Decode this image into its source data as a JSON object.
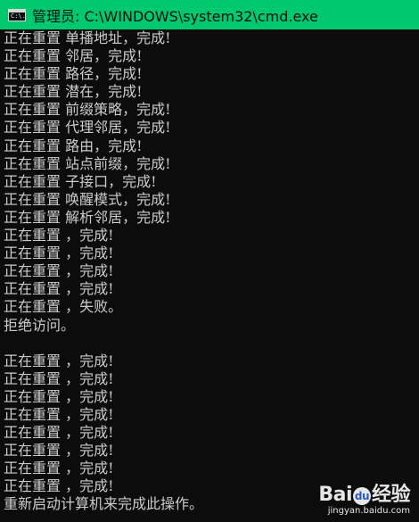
{
  "window": {
    "title": "管理员: C:\\WINDOWS\\system32\\cmd.exe",
    "icon": "cmd-icon",
    "icon_text": "C:\\."
  },
  "colors": {
    "titlebar": "#00c86e",
    "console_bg": "#0c0c0c",
    "console_text": "#cccccc"
  },
  "console": {
    "lines": [
      "正在重置 单播地址，完成!",
      "正在重置 邻居，完成!",
      "正在重置 路径，完成!",
      "正在重置 潜在，完成!",
      "正在重置 前缀策略，完成!",
      "正在重置 代理邻居，完成!",
      "正在重置 路由，完成!",
      "正在重置 站点前缀，完成!",
      "正在重置 子接口，完成!",
      "正在重置 唤醒模式，完成!",
      "正在重置 解析邻居，完成!",
      "正在重置 ，完成!",
      "正在重置 ，完成!",
      "正在重置 ，完成!",
      "正在重置 ，完成!",
      "正在重置 ，失败。",
      "拒绝访问。",
      "",
      "正在重置 ，完成!",
      "正在重置 ，完成!",
      "正在重置 ，完成!",
      "正在重置 ，完成!",
      "正在重置 ，完成!",
      "正在重置 ，完成!",
      "正在重置 ，完成!",
      "正在重置 ，完成!",
      "重新启动计算机来完成此操作。"
    ]
  },
  "watermark": {
    "logo_left": "Bai",
    "logo_paw": "du",
    "logo_right": "经验",
    "url": "jingyan.baidu.com"
  }
}
